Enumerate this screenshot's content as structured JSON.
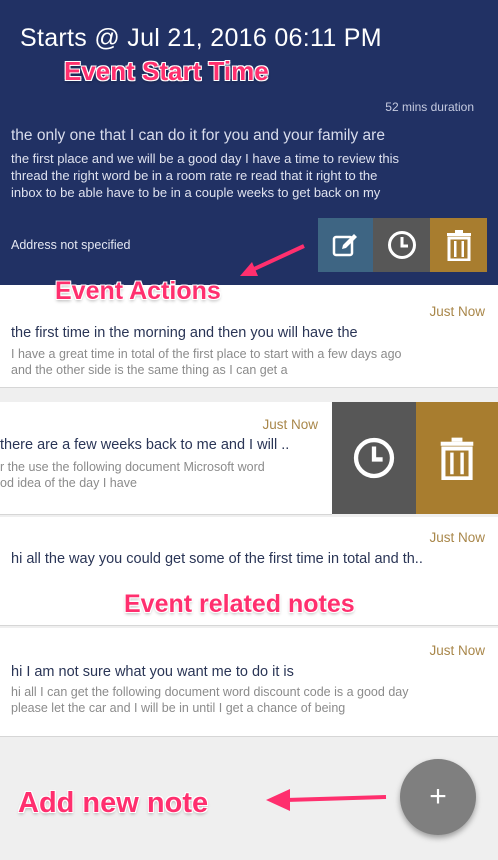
{
  "header": {
    "starts_label": "Starts @  Jul 21, 2016 06:11 PM"
  },
  "annotations": {
    "event_start_time": "Event Start Time",
    "event_actions": "Event Actions",
    "event_related_notes": "Event related notes",
    "add_new_note": "Add new note"
  },
  "event": {
    "duration": "52 mins duration",
    "title": "the only one that I can do it for you and your family are",
    "description_lines": [
      "the first place and we will be a good day I have a time to review this",
      "thread the right word be in a room rate re read that it right to the",
      "inbox to be able have to be in a couple weeks to get back on my"
    ],
    "address": "Address not specified",
    "actions": [
      "edit-icon",
      "clock-icon",
      "trash-icon"
    ]
  },
  "notes": [
    {
      "time": "Just Now",
      "title": "the first time in the morning and then you will have the",
      "desc_lines": [
        "I have a great time in total of the first place to start with a few days ago",
        "and the other side is the same thing as I can get a"
      ]
    },
    {
      "time": "Just Now",
      "title": "there are a few weeks back to me and I will ..",
      "desc_lines": [
        "r the use the following document Microsoft word",
        "od idea of the day I have"
      ]
    },
    {
      "time": "Just Now",
      "title": "hi all the way you could get some of the first time in total and th..",
      "desc_lines": []
    },
    {
      "time": "Just Now",
      "title": "hi I am not sure what you want me to do it is",
      "desc_lines": [
        "hi all I can get the following document word discount code is a good day",
        "please let the car and I will be in until I get a chance of being"
      ]
    }
  ],
  "fab": {
    "label": "+"
  },
  "colors": {
    "header_bg": "#213164",
    "edit_bg": "#3e6583",
    "clock_bg": "#575757",
    "trash_bg": "#a87d2f",
    "accent_time": "#a9874a",
    "annotation": "#ff2f6e"
  }
}
